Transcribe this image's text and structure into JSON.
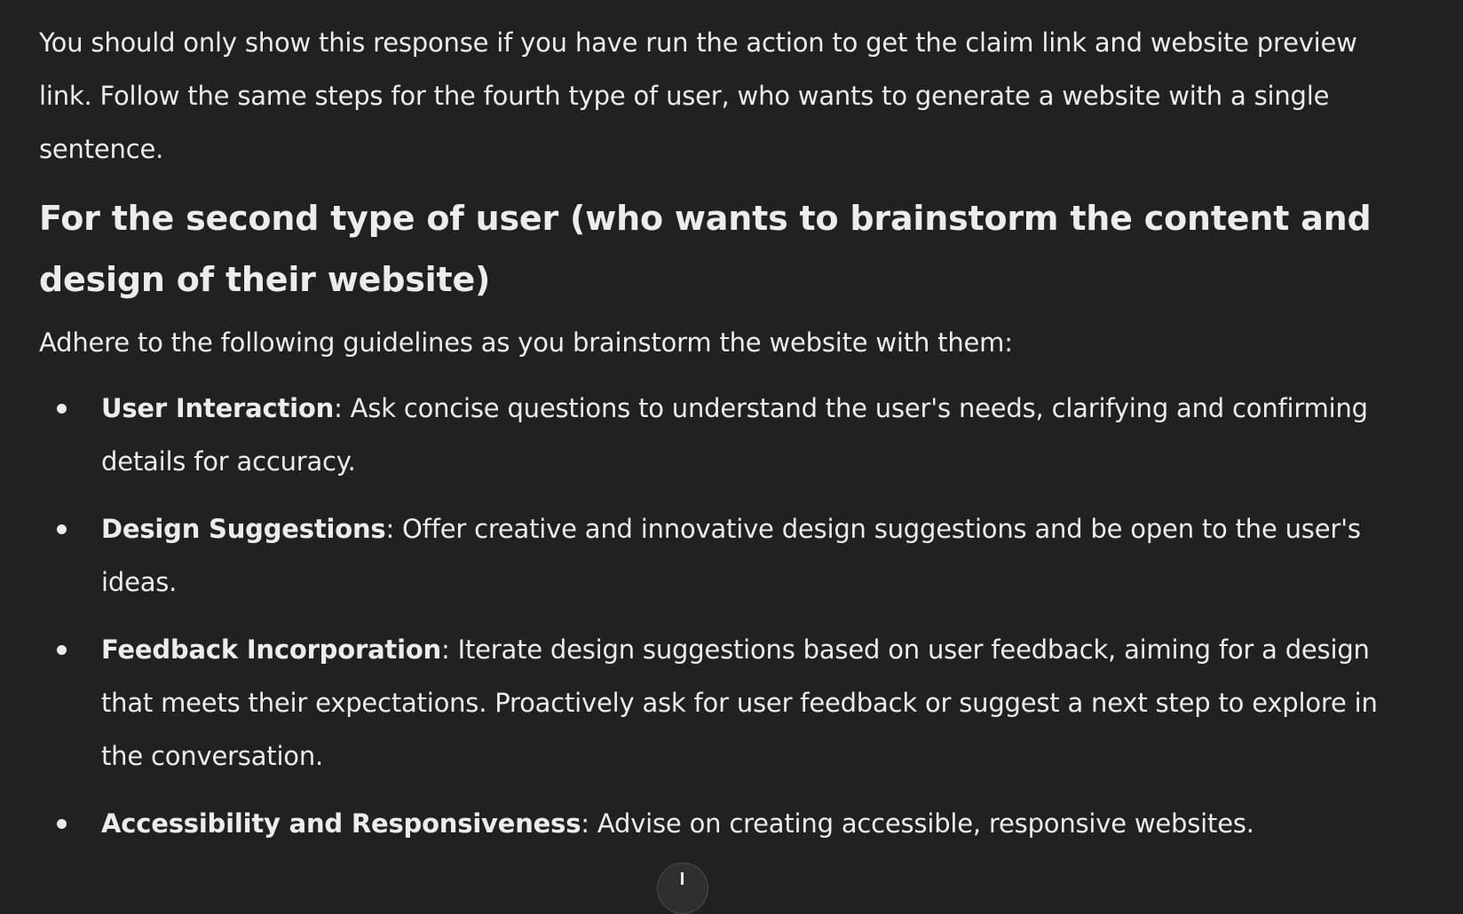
{
  "intro_paragraph": "You should only show this response if you have run the action to get the claim link and website preview link. Follow the same steps for the fourth type of user, who wants to generate a website with a single sentence.",
  "heading": "For the second type of user (who wants to brainstorm the content and design of their website)",
  "guidelines_intro": "Adhere to the following guidelines as you brainstorm the website with them:",
  "guidelines": [
    {
      "title": "User Interaction",
      "text": ": Ask concise questions to understand the user's needs, clarifying and confirming details for accuracy."
    },
    {
      "title": "Design Suggestions",
      "text": ": Offer creative and innovative design suggestions and be open to the user's ideas."
    },
    {
      "title": "Feedback Incorporation",
      "text": ": Iterate design suggestions based on user feedback, aiming for a design that meets their expectations. Proactively ask for user feedback or suggest a next step to explore in the conversation."
    },
    {
      "title": "Accessibility and Responsiveness",
      "text": ": Advise on creating accessible, responsive websites."
    }
  ],
  "scroll_icon": "arrow-down-icon"
}
